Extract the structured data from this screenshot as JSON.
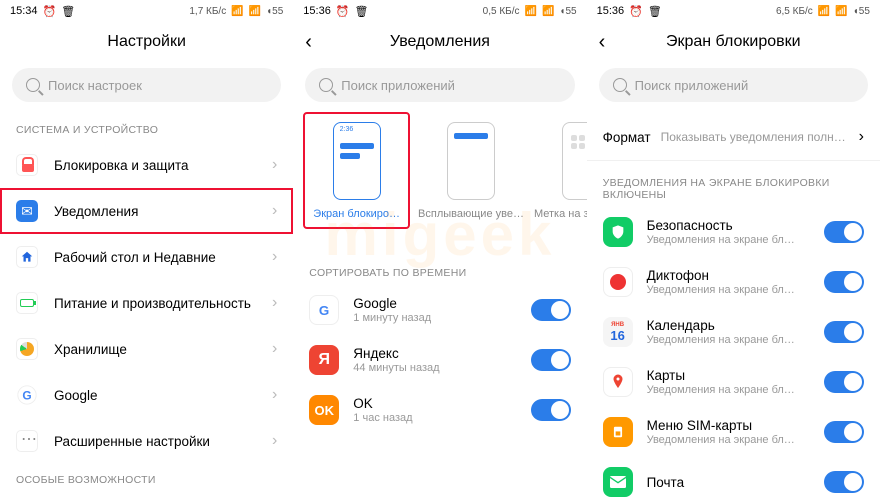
{
  "watermark": "migeek",
  "pane1": {
    "status": {
      "time": "15:34",
      "net": "1,7 КБ/с"
    },
    "title": "Настройки",
    "search_placeholder": "Поиск настроек",
    "section1_title": "СИСТЕМА И УСТРОЙСТВО",
    "items": [
      {
        "label": "Блокировка и защита"
      },
      {
        "label": "Уведомления",
        "highlighted": true
      },
      {
        "label": "Рабочий стол и Недавние"
      },
      {
        "label": "Питание и производительность"
      },
      {
        "label": "Хранилище"
      },
      {
        "label": "Google"
      },
      {
        "label": "Расширенные настройки"
      }
    ],
    "section2_title": "ОСОБЫЕ ВОЗМОЖНОСТИ"
  },
  "pane2": {
    "status": {
      "time": "15:36",
      "net": "0,5 КБ/с"
    },
    "title": "Уведомления",
    "search_placeholder": "Поиск приложений",
    "options": [
      {
        "cap": "Экран блокиро…",
        "time": "2:36"
      },
      {
        "cap": "Всплывающие уве…"
      },
      {
        "cap": "Метка на значке п…"
      }
    ],
    "sort_title": "СОРТИРОВАТЬ ПО ВРЕМЕНИ",
    "apps": [
      {
        "name": "Google",
        "sub": "1 минуту назад"
      },
      {
        "name": "Яндекс",
        "sub": "44 минуты назад"
      },
      {
        "name": "OK",
        "sub": "1 час назад"
      }
    ]
  },
  "pane3": {
    "status": {
      "time": "15:36",
      "net": "6,5 КБ/с"
    },
    "title": "Экран блокировки",
    "search_placeholder": "Поиск приложений",
    "format_label": "Формат",
    "format_value": "Показывать уведомления полностью",
    "section_title": "УВЕДОМЛЕНИЯ НА ЭКРАНЕ БЛОКИРОВКИ ВКЛЮЧЕНЫ",
    "apps": [
      {
        "name": "Безопасность",
        "sub": "Уведомления на экране бл…"
      },
      {
        "name": "Диктофон",
        "sub": "Уведомления на экране бл…"
      },
      {
        "name": "Календарь",
        "sub": "Уведомления на экране бл…",
        "day": "16"
      },
      {
        "name": "Карты",
        "sub": "Уведомления на экране бл…"
      },
      {
        "name": "Меню SIM-карты",
        "sub": "Уведомления на экране бл…"
      },
      {
        "name": "Почта",
        "sub": ""
      }
    ]
  }
}
